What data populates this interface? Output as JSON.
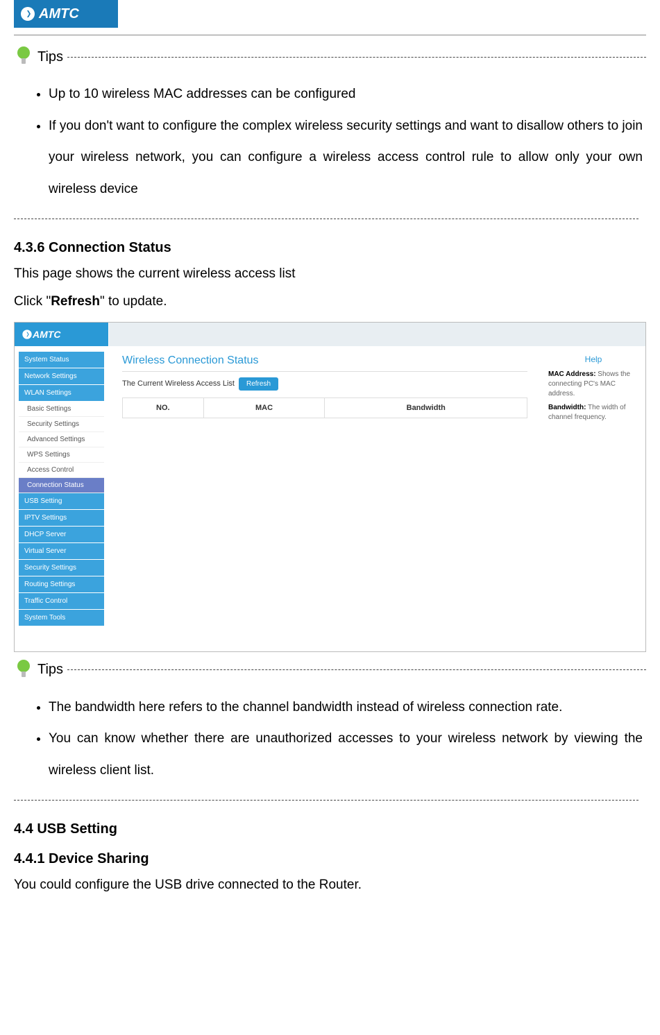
{
  "logo_text": "AMTC",
  "tips_label": "Tips",
  "tips1": [
    "Up to 10 wireless MAC addresses can be configured",
    "If you don't want to configure the complex wireless security settings and want to disallow others to join your wireless network, you can configure a wireless access control rule to allow only your own wireless device"
  ],
  "section_436_heading": "4.3.6 Connection Status",
  "section_436_line1": "This page shows the current wireless access list",
  "section_436_line2_prefix": "Click \"",
  "section_436_line2_bold": "Refresh",
  "section_436_line2_suffix": "\" to update.",
  "ui": {
    "logo": "AMTC",
    "sidebar": {
      "items": [
        "System Status",
        "Network Settings",
        "WLAN Settings"
      ],
      "subs": [
        "Basic Settings",
        "Security Settings",
        "Advanced Settings",
        "WPS Settings",
        "Access Control",
        "Connection Status"
      ],
      "items2": [
        "USB Setting",
        "IPTV Settings",
        "DHCP Server",
        "Virtual Server",
        "Security Settings",
        "Routing Settings",
        "Traffic Control",
        "System Tools"
      ]
    },
    "main": {
      "title": "Wireless Connection Status",
      "subtitle": "The Current Wireless Access List",
      "refresh": "Refresh",
      "cols": [
        "NO.",
        "MAC",
        "Bandwidth"
      ]
    },
    "help": {
      "title": "Help",
      "mac_label": "MAC Address:",
      "mac_text": " Shows the connecting PC's MAC address.",
      "bw_label": "Bandwidth:",
      "bw_text": " The width of channel frequency."
    }
  },
  "tips2": [
    "The bandwidth here refers to the channel bandwidth instead of wireless connection rate.",
    "You can know whether there are unauthorized accesses to your wireless network by viewing the wireless client list."
  ],
  "section_44_heading": "4.4 USB Setting",
  "section_441_heading": "4.4.1 Device Sharing",
  "section_441_text": "You could configure the USB drive connected to the Router."
}
